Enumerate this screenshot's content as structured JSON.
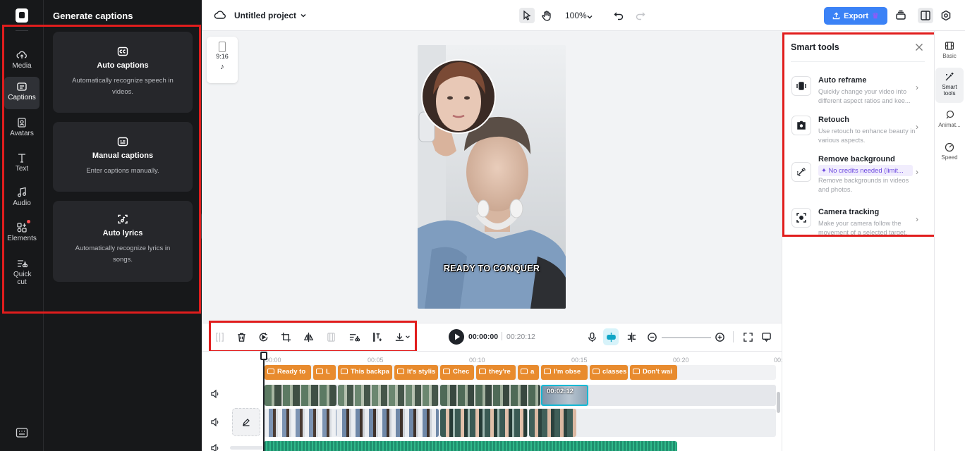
{
  "rail": {
    "items": [
      {
        "label": "Media",
        "icon": "cloud-upload-icon"
      },
      {
        "label": "Captions",
        "icon": "captions-icon",
        "active": true
      },
      {
        "label": "Avatars",
        "icon": "avatar-icon"
      },
      {
        "label": "Text",
        "icon": "text-icon"
      },
      {
        "label": "Audio",
        "icon": "music-icon"
      },
      {
        "label": "Elements",
        "icon": "elements-icon",
        "badge": true
      },
      {
        "label": "Quick cut",
        "icon": "quick-cut-icon"
      }
    ],
    "bottom_icon": "keyboard-icon"
  },
  "captions_panel": {
    "title": "Generate captions",
    "cards": [
      {
        "title": "Auto captions",
        "desc": "Automatically recognize speech in videos.",
        "icon": "cc-icon"
      },
      {
        "title": "Manual captions",
        "desc": "Enter captions manually.",
        "icon": "subtitle-icon"
      },
      {
        "title": "Auto lyrics",
        "desc": "Automatically recognize lyrics in songs.",
        "icon": "lyrics-icon"
      }
    ]
  },
  "topbar": {
    "project_name": "Untitled project",
    "zoom": "100%",
    "export_label": "Export"
  },
  "canvas": {
    "ratio": "9:16",
    "video_caption": "READY TO CONQUER"
  },
  "smart_tools": {
    "title": "Smart tools",
    "tools": [
      {
        "name": "Auto reframe",
        "desc": "Quickly change your video into different aspect ratios and kee...",
        "icon": "reframe-icon"
      },
      {
        "name": "Retouch",
        "desc": "Use retouch to enhance beauty in various aspects.",
        "icon": "retouch-icon"
      },
      {
        "name": "Remove background",
        "badge": "✦ No credits needed (limit...",
        "desc": "Remove backgrounds in videos and photos.",
        "icon": "remove-bg-icon"
      },
      {
        "name": "Camera tracking",
        "desc": "Make your camera follow the movement of a selected target.",
        "icon": "camera-tracking-icon"
      }
    ]
  },
  "right_tabs": [
    {
      "label": "Basic",
      "icon": "basic-icon"
    },
    {
      "label": "Smart tools",
      "icon": "smart-tools-icon",
      "active": true
    },
    {
      "label": "Animat...",
      "icon": "animation-icon"
    },
    {
      "label": "Speed",
      "icon": "speed-icon"
    }
  ],
  "player": {
    "current_time": "00:00:00",
    "duration": "00:20:12"
  },
  "timeline": {
    "ruler": [
      "00:00",
      "00:05",
      "00:10",
      "00:15",
      "00:20",
      "00:"
    ],
    "caption_clips": [
      "Ready to",
      "L",
      "This backpa",
      "It's stylis",
      "Chec",
      "they're",
      "a",
      "I'm obse",
      "classes",
      "Don't wai"
    ],
    "clip_duration_label": "00:02:12"
  }
}
